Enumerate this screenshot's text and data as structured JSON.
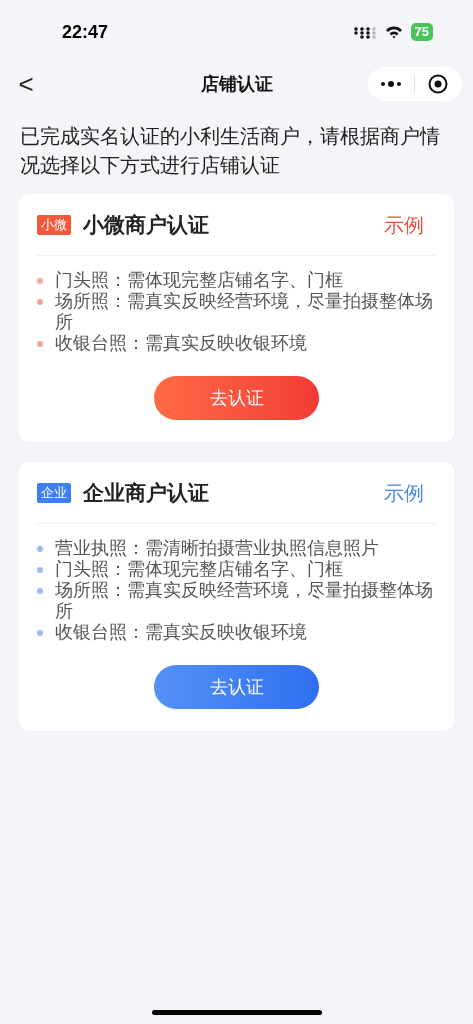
{
  "status_bar": {
    "time": "22:47",
    "battery": "75"
  },
  "nav": {
    "back": "<",
    "title": "店铺认证"
  },
  "intro": "已完成实名认证的小利生活商户，请根据商户情况选择以下方式进行店铺认证",
  "cards": [
    {
      "kind": "micro",
      "badge": "小微",
      "title": "小微商户认证",
      "example": "示例",
      "items": [
        "门头照：需体现完整店铺名字、门框",
        "场所照：需真实反映经营环境，尽量拍摄整体场所",
        "收银台照：需真实反映收银环境"
      ],
      "button": "去认证"
    },
    {
      "kind": "enterprise",
      "badge": "企业",
      "title": "企业商户认证",
      "example": "示例",
      "items": [
        "营业执照：需清晰拍摄营业执照信息照片",
        "门头照：需体现完整店铺名字、门框",
        "场所照：需真实反映经营环境，尽量拍摄整体场所",
        "收银台照：需真实反映收银环境"
      ],
      "button": "去认证"
    }
  ]
}
